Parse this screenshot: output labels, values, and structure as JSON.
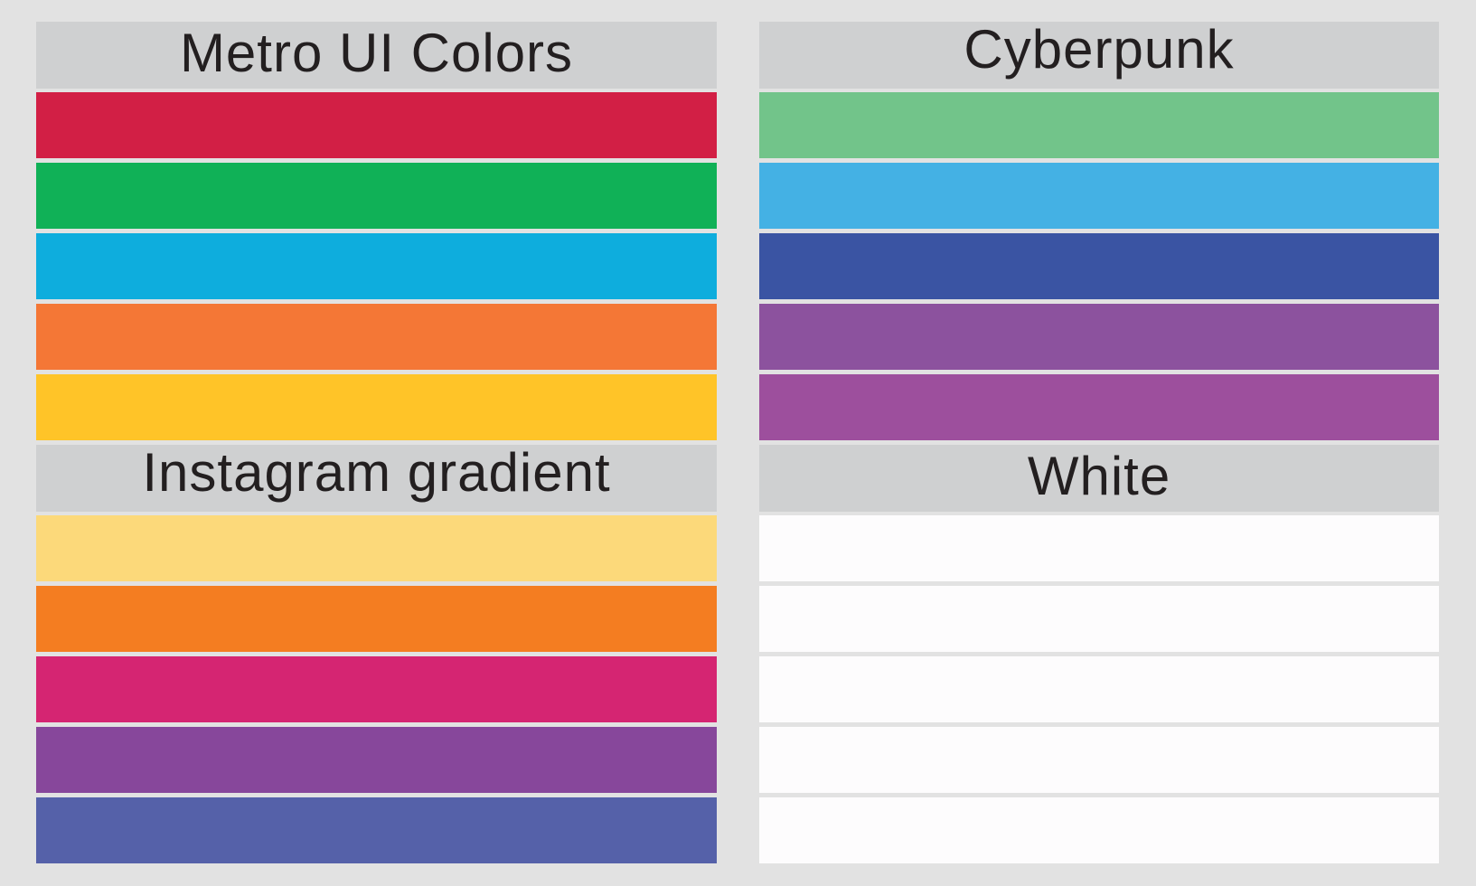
{
  "palettes": {
    "metro": {
      "title": "Metro UI Colors",
      "colors": [
        "#D21F45",
        "#10B157",
        "#0EADDD",
        "#F47736",
        "#FFC428"
      ]
    },
    "cyberpunk": {
      "title": "Cyberpunk",
      "colors": [
        "#72C48A",
        "#44B1E4",
        "#3A54A3",
        "#8C529E",
        "#9D4F9D"
      ]
    },
    "instagram": {
      "title": "Instagram gradient",
      "colors": [
        "#FCD97A",
        "#F47D21",
        "#D52572",
        "#87479B",
        "#5561A9"
      ]
    },
    "white": {
      "title": "White",
      "colors": [
        "#FDFCFD",
        "#FDFCFD",
        "#FDFCFD",
        "#FDFCFD",
        "#FDFCFD"
      ]
    }
  }
}
